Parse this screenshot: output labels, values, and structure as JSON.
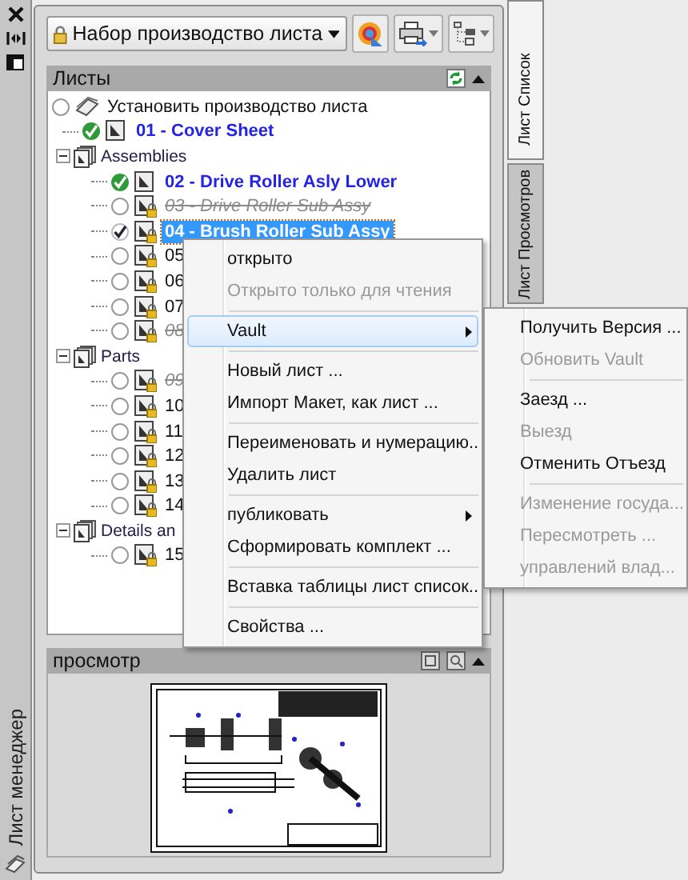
{
  "window": {
    "side_label": "Лист менеджер"
  },
  "toolbar": {
    "sheet_set": "Набор производство листа"
  },
  "side_tabs": [
    {
      "label": "Лист Список",
      "selected": true
    },
    {
      "label": "Лист Просмотров",
      "selected": false
    }
  ],
  "sheets_panel": {
    "title": "Листы",
    "tree": [
      {
        "kind": "root",
        "label": "Установить производство листа",
        "current": false,
        "checked": false,
        "selected": false,
        "children": [
          {
            "kind": "link-sheet",
            "label": "01 - Cover Sheet",
            "current": true,
            "checked": false,
            "locked": false,
            "selected": false
          },
          {
            "kind": "group",
            "label": "Assemblies",
            "expanded": true,
            "selected": false,
            "children": [
              {
                "kind": "link-sheet",
                "label": "02 - Drive Roller Asly Lower",
                "current": true,
                "checked": false,
                "locked": false,
                "selected": false
              },
              {
                "kind": "missing-sheet",
                "label": "03 - Drive Roller Sub Assy",
                "current": false,
                "checked": false,
                "locked": true,
                "selected": false
              },
              {
                "kind": "link-sheet",
                "label": "04 - Brush Roller Sub Assy",
                "current": false,
                "checked": true,
                "locked": true,
                "selected": true
              },
              {
                "kind": "sheet",
                "label": "05",
                "current": false,
                "checked": false,
                "locked": true,
                "selected": false
              },
              {
                "kind": "sheet",
                "label": "06",
                "current": false,
                "checked": false,
                "locked": true,
                "selected": false
              },
              {
                "kind": "sheet",
                "label": "07",
                "current": false,
                "checked": false,
                "locked": true,
                "selected": false
              },
              {
                "kind": "missing-sheet",
                "label": "08",
                "current": false,
                "checked": false,
                "locked": true,
                "selected": false
              }
            ]
          },
          {
            "kind": "group",
            "label": "Parts",
            "expanded": true,
            "selected": false,
            "children": [
              {
                "kind": "missing-sheet",
                "label": "09",
                "current": false,
                "checked": false,
                "locked": true,
                "selected": false
              },
              {
                "kind": "sheet",
                "label": "10",
                "current": false,
                "checked": false,
                "locked": true,
                "selected": false
              },
              {
                "kind": "sheet",
                "label": "11",
                "current": false,
                "checked": false,
                "locked": true,
                "selected": false
              },
              {
                "kind": "sheet",
                "label": "12",
                "current": false,
                "checked": false,
                "locked": true,
                "selected": false
              },
              {
                "kind": "sheet",
                "label": "13",
                "current": false,
                "checked": false,
                "locked": true,
                "selected": false
              },
              {
                "kind": "sheet",
                "label": "14",
                "current": false,
                "checked": false,
                "locked": true,
                "selected": false
              }
            ]
          },
          {
            "kind": "group",
            "label": "Details an",
            "expanded": true,
            "selected": false,
            "children": [
              {
                "kind": "sheet",
                "label": "15",
                "current": false,
                "checked": false,
                "locked": true,
                "selected": false
              }
            ]
          }
        ]
      }
    ]
  },
  "preview_panel": {
    "title": "просмотр"
  },
  "context_menu": {
    "groups": [
      [
        {
          "label": "открыто",
          "disabled": false,
          "submenu": false,
          "selected": false
        },
        {
          "label": "Открыто только для чтения",
          "disabled": true,
          "submenu": false,
          "selected": false
        }
      ],
      [
        {
          "label": "Vault",
          "disabled": false,
          "submenu": true,
          "selected": true
        }
      ],
      [
        {
          "label": "Новый лист ...",
          "disabled": false,
          "submenu": false,
          "selected": false
        },
        {
          "label": "Импорт Макет, как лист ...",
          "disabled": false,
          "submenu": false,
          "selected": false
        }
      ],
      [
        {
          "label": "Переименовать и нумерацию..",
          "disabled": false,
          "submenu": false,
          "selected": false
        },
        {
          "label": "Удалить лист",
          "disabled": false,
          "submenu": false,
          "selected": false
        }
      ],
      [
        {
          "label": "публиковать",
          "disabled": false,
          "submenu": true,
          "selected": false
        },
        {
          "label": "Сформировать комплект ...",
          "disabled": false,
          "submenu": false,
          "selected": false
        }
      ],
      [
        {
          "label": "Вставка таблицы лист список..",
          "disabled": false,
          "submenu": false,
          "selected": false
        }
      ],
      [
        {
          "label": "Свойства ...",
          "disabled": false,
          "submenu": false,
          "selected": false
        }
      ]
    ]
  },
  "submenu": {
    "groups": [
      [
        {
          "label": "Получить Версия ...",
          "disabled": false
        },
        {
          "label": "Обновить Vault",
          "disabled": true
        }
      ],
      [
        {
          "label": "Заезд ...",
          "disabled": false
        },
        {
          "label": "Выезд",
          "disabled": true
        },
        {
          "label": "Отменить Отъезд",
          "disabled": false
        }
      ],
      [
        {
          "label": "Изменение госуда...",
          "disabled": true
        },
        {
          "label": "Пересмотреть ...",
          "disabled": true
        },
        {
          "label": "управлений влад...",
          "disabled": true
        }
      ]
    ]
  }
}
